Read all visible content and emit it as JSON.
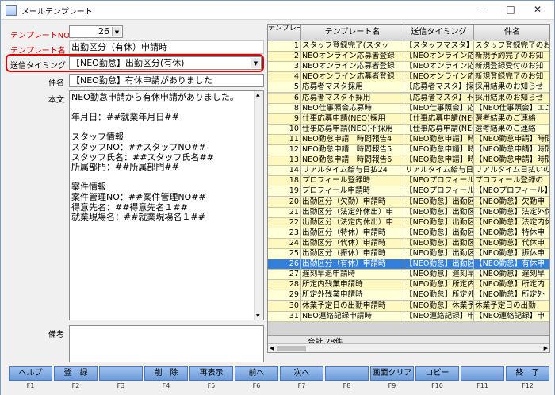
{
  "window": {
    "title": "メールテンプレート"
  },
  "form": {
    "template_no_label": "テンプレートNO",
    "template_no_value": "26",
    "template_name_label": "テンプレート名",
    "template_name_value": "出勤区分（有休）申請時",
    "timing_label": "送信タイミング",
    "timing_value": "【NEO勤怠】出勤区分(有休)",
    "subject_label": "件名",
    "subject_value": "【NEO勤怠】有休申請がありました",
    "body_label": "本文",
    "body_value": "NEO勤怠申請から有休申請がありました。\n\n年月日：##就業年月日##\n\nスタッフ情報\nスタッフNO：##スタッフNO##\nスタッフ氏名：##スタッフ氏名##\n所属部門：##所属部門##\n\n案件情報\n案件管理NO：##案件管理NO##\n得意先名：##得意先名１##\n就業現場名：##就業現場名１##",
    "remarks_label": "備考",
    "remarks_value": ""
  },
  "grid": {
    "headers": [
      "テンプレートNO",
      "テンプレート名",
      "送信タイミング",
      "件名"
    ],
    "rows": [
      [
        "1",
        "スタッフ登録完了(スタッ",
        "【スタッフマスタ】",
        "スタッフ登録完了のお"
      ],
      [
        "2",
        "NEOオンライン応募者登録",
        "【NEOオンライン応募",
        "新規予約完了のお知"
      ],
      [
        "3",
        "NEOオンライン応募者登録",
        "【NEOオンライン応募",
        "新規登録受付のお知"
      ],
      [
        "4",
        "NEOオンライン応募者登録",
        "【NEOオンライン応募",
        "新規登録完了のお知"
      ],
      [
        "5",
        "応募者マスタ採用",
        "【応募者マスタ】採",
        "採用結果のお知らせ"
      ],
      [
        "6",
        "応募者マスタ不採用",
        "【応募者マスタ】不",
        "採用結果のお知らせ"
      ],
      [
        "8",
        "NEO仕事照会応募時",
        "【NEO仕事照会】応募",
        "【NEO仕事照会】エン"
      ],
      [
        "9",
        "仕事応募申請(NEO)採用",
        "【仕事応募申請(NEO",
        "選考結果のご連絡"
      ],
      [
        "10",
        "仕事応募申請(NEO)不採用",
        "【仕事応募申請(NEO",
        "選考結果のご連絡"
      ],
      [
        "11",
        "NEO勤怠申請　時間報告4",
        "【NEO勤怠申請】時間",
        "【NEO勤怠申請】時間"
      ],
      [
        "12",
        "NEO勤怠申請　時間報告5",
        "【NEO勤怠申請】時間",
        "【NEO勤怠申請】時間"
      ],
      [
        "13",
        "NEO勤怠申請　時間報告6",
        "【NEO勤怠申請】時間",
        "【NEO勤怠申請】時間"
      ],
      [
        "14",
        "リアルタイム給与日払24",
        "リアルタイム給与日払24",
        "リアルタイム日払いの"
      ],
      [
        "18",
        "プロフィール登録時",
        "【NEOプロフィール申",
        "プロフィール登録の"
      ],
      [
        "19",
        "プロフィール申請時",
        "【NEOプロフィール申",
        "【NEOプロフィール】"
      ],
      [
        "20",
        "出勤区分（欠勤）申請時",
        "【NEO勤怠】出勤区分",
        "【NEO勤怠】欠勤申"
      ],
      [
        "21",
        "出勤区分（法定外休出）申",
        "【NEO勤怠】出勤区分",
        "【NEO勤怠】法定外休"
      ],
      [
        "22",
        "出勤区分（法定内休出）申",
        "【NEO勤怠】出勤区分",
        "【NEO勤怠】法定内休"
      ],
      [
        "23",
        "出勤区分（特休）申請時",
        "【NEO勤怠】出勤区分",
        "【NEO勤怠】特休申"
      ],
      [
        "24",
        "出勤区分（代休）申請時",
        "【NEO勤怠】出勤区分",
        "【NEO勤怠】代休申"
      ],
      [
        "25",
        "出勤区分（振休）申請時",
        "【NEO勤怠】出勤区分",
        "【NEO勤怠】振休申"
      ],
      [
        "26",
        "出勤区分（有休）申請時",
        "【NEO勤怠】出勤区分",
        "【NEO勤怠】有休申"
      ],
      [
        "27",
        "遅刻早退申請時",
        "【NEO勤怠】遅刻早退",
        "【NEO勤怠】遅刻早"
      ],
      [
        "28",
        "所定内残業申請時",
        "【NEO勤怠】所定内残",
        "【NEO勤怠】所定内"
      ],
      [
        "29",
        "所定外残業申請時",
        "【NEO勤怠】所定外残",
        "【NEO勤怠】所定外"
      ],
      [
        "30",
        "休業予定日の出勤申請時",
        "【NEO勤怠】休業予定",
        "休業予定日の出勤"
      ],
      [
        "31",
        "NEO連絡記録申請時",
        "【NEO連絡記録】申請",
        "【NEO連絡記録】申"
      ]
    ],
    "selected_no": "26",
    "footer_label": "合計 28件"
  },
  "fkeys": [
    {
      "label": "ヘルプ",
      "key": "F1"
    },
    {
      "label": "登　録",
      "key": "F2"
    },
    {
      "label": "",
      "key": "F3"
    },
    {
      "label": "削　除",
      "key": "F4"
    },
    {
      "label": "再表示",
      "key": "F5"
    },
    {
      "label": "前へ",
      "key": "F6"
    },
    {
      "label": "次へ",
      "key": "F7"
    },
    {
      "label": "",
      "key": "F8"
    },
    {
      "label": "画面クリア",
      "key": "F9"
    },
    {
      "label": "コピー",
      "key": "F10"
    },
    {
      "label": "",
      "key": "F11"
    },
    {
      "label": "終　了",
      "key": "F12"
    }
  ],
  "colors": {
    "label_red": "#d00000",
    "row_selected": "#3280dc",
    "row_yellow": "#ffffd8",
    "fkey_blue": "#8ab3e6"
  }
}
